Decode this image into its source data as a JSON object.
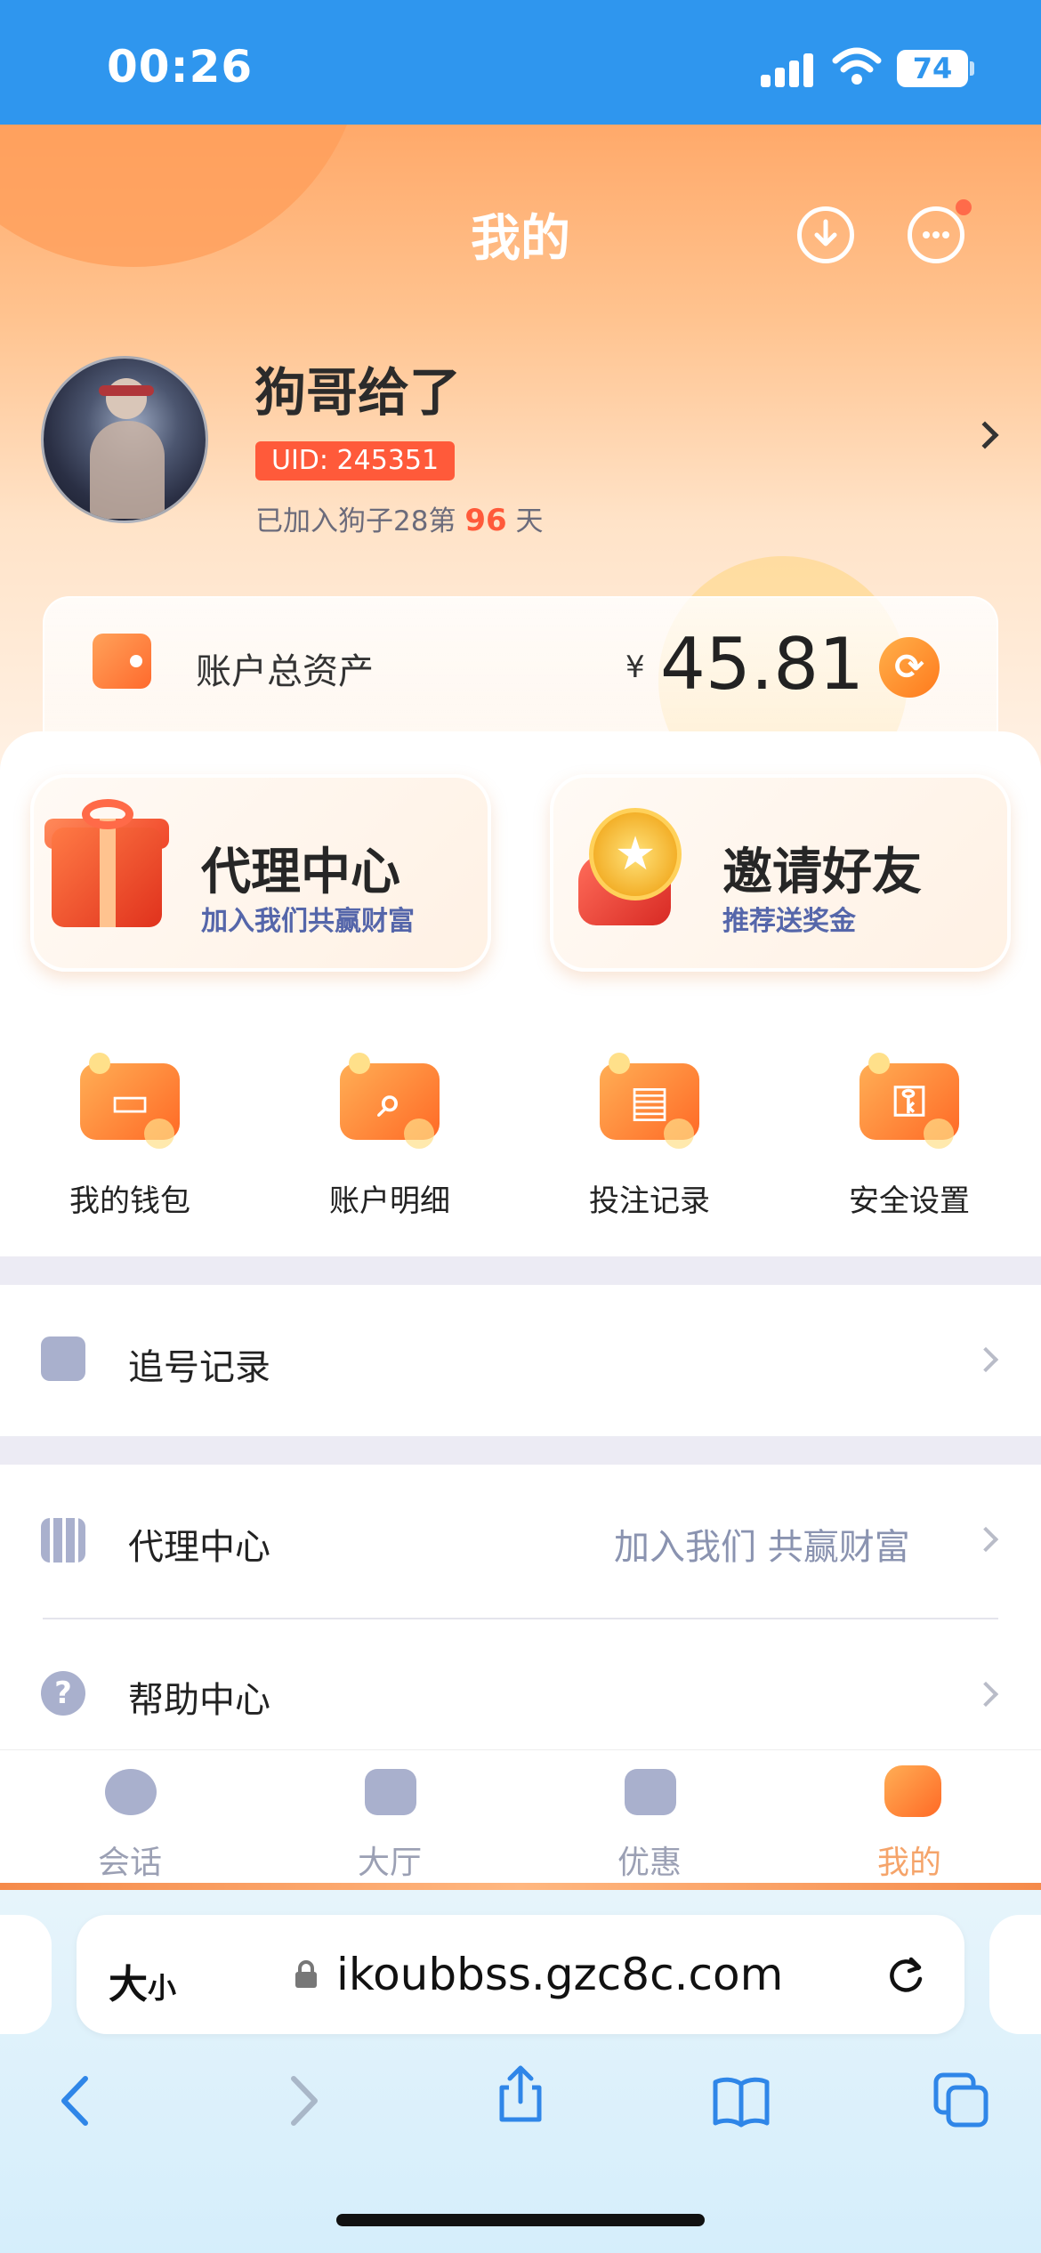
{
  "status": {
    "time": "00:26",
    "battery": "74"
  },
  "header": {
    "title": "我的"
  },
  "profile": {
    "name": "狗哥给了",
    "uid": "UID: 245351",
    "joined_prefix": "已加入狗子28第",
    "joined_days": "96",
    "joined_suffix": "天"
  },
  "assets": {
    "label": "账户总资产",
    "currency": "¥",
    "amount": "45.81"
  },
  "promos": [
    {
      "title": "代理中心",
      "subtitle": "加入我们共赢财富"
    },
    {
      "title": "邀请好友",
      "subtitle": "推荐送奖金"
    }
  ],
  "quick_actions": [
    {
      "label": "我的钱包",
      "icon": "wallet-icon"
    },
    {
      "label": "账户明细",
      "icon": "magnifier-icon"
    },
    {
      "label": "投注记录",
      "icon": "ticket-icon"
    },
    {
      "label": "安全设置",
      "icon": "key-icon"
    }
  ],
  "menu": {
    "chase": {
      "label": "追号记录"
    },
    "agent": {
      "label": "代理中心",
      "extra": "加入我们 共赢财富"
    },
    "help": {
      "label": "帮助中心"
    }
  },
  "tabs": [
    {
      "label": "会话",
      "icon": "chat-icon"
    },
    {
      "label": "大厅",
      "icon": "bank-icon"
    },
    {
      "label": "优惠",
      "icon": "coupon-icon"
    },
    {
      "label": "我的",
      "icon": "user-icon",
      "active": true
    }
  ],
  "browser": {
    "text_size": "大",
    "text_size_small": "小",
    "url": "ikoubbss.gzc8c.com"
  },
  "colors": {
    "accent": "#ff7a1d",
    "status_bar": "#2f96ee",
    "active_tab": "#f5a46a"
  }
}
